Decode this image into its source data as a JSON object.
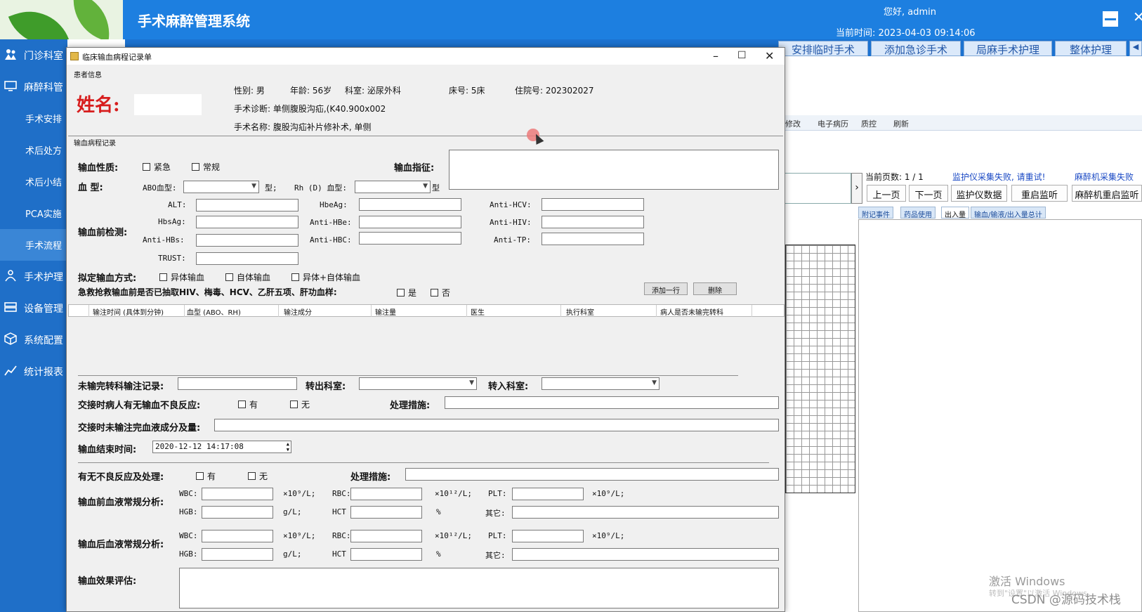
{
  "header": {
    "title": "手术麻醉管理系统",
    "greeting": "您好, admin",
    "clock": "当前时间: 2023-04-03 09:14:06"
  },
  "sidebar": {
    "items": [
      {
        "label": "门诊科室",
        "icon": "people-icon"
      },
      {
        "label": "麻醉科管",
        "icon": "monitor-icon"
      },
      {
        "label": "手术安排"
      },
      {
        "label": "术后处方"
      },
      {
        "label": "术后小结"
      },
      {
        "label": "PCA实施"
      },
      {
        "label": "手术流程"
      },
      {
        "label": "手术护理",
        "icon": "nurse-icon"
      },
      {
        "label": "设备管理",
        "icon": "device-icon"
      },
      {
        "label": "系统配置",
        "icon": "cube-icon"
      },
      {
        "label": "统计报表",
        "icon": "chart-icon"
      }
    ]
  },
  "tabs": [
    "安排临时手术",
    "添加急诊手术",
    "局麻手术护理",
    "整体护理"
  ],
  "toolbar": {
    "edit": "修改",
    "emr": "电子病历",
    "qc": "质控",
    "refresh": "刷新"
  },
  "bg": {
    "page_info": "当前页数: 1 / 1",
    "monitor_fail": "监护仪采集失败, 请重试!",
    "anesthesia_fail": "麻醉机采集失败",
    "buttons": [
      "上一页",
      "下一页",
      "监护仪数据",
      "重启监听",
      "麻醉机重启监听"
    ],
    "subtabs": [
      "附记事件",
      "药品使用",
      "出入量",
      "输血/输液/出入量总计"
    ]
  },
  "watermark": {
    "line1": "激活 Windows",
    "line2": "转到\"设置\"以激活 Windows。",
    "source": "CSDN @源码技术栈"
  },
  "dialog": {
    "title": "临床输血病程记录单",
    "patient_group": "患者信息",
    "name_label": "姓名:",
    "gender": "性别: 男",
    "age": "年龄: 56岁",
    "dept": "科室: 泌尿外科",
    "bed": "床号: 5床",
    "admission": "住院号: 202302027",
    "diagnosis": "手术诊断: 单侧腹股沟疝,(K40.900x002",
    "surgery": "手术名称: 腹股沟疝补片修补术, 单侧",
    "record_group": "输血病程记录",
    "nature_label": "输血性质:",
    "urgent": "紧急",
    "routine": "常规",
    "indication_label": "输血指征:",
    "blood_type_label": "血    型:",
    "abo_label": "ABO血型:",
    "type_suffix": "型;",
    "rh_label": "Rh (D) 血型:",
    "type_suffix2": "型",
    "pretest_label": "输血前检测:",
    "tests": {
      "alt": "ALT:",
      "hbsag": "HbsAg:",
      "antihbs": "Anti-HBs:",
      "trust": "TRUST:",
      "hbeag": "HbeAg:",
      "antihbe": "Anti-HBe:",
      "antihbc": "Anti-HBC:",
      "antihcv": "Anti-HCV:",
      "antihiv": "Anti-HIV:",
      "antitp": "Anti-TP:"
    },
    "method_label": "拟定输血方式:",
    "m1": "异体输血",
    "m2": "自体输血",
    "m3": "异体+自体输血",
    "emergency_label": "急救抢救输血前是否已抽取HIV、梅毒、HCV、乙肝五项、肝功血样:",
    "yes": "是",
    "no": "否",
    "add_row": "添加一行",
    "delete": "删除",
    "columns": [
      "输注时间 (具体到分钟)",
      "血型 (ABO、RH)",
      "输注成分",
      "输注量",
      "医生",
      "执行科室",
      "病人是否未输完转科"
    ],
    "transfer_label": "未输完转科输注记录:",
    "out_dept": "转出科室:",
    "in_dept": "转入科室:",
    "handover_label": "交接时病人有无输血不良反应:",
    "has": "有",
    "none": "无",
    "measures": "处理措施:",
    "remaining_label": "交接时未输注完血液成分及量:",
    "end_label": "输血结束时间:",
    "end_time": "2020-12-12  14:17:08",
    "adverse_label": "有无不良反应及处理:",
    "pre_cbc": "输血前血液常规分析:",
    "post_cbc": "输血后血液常规分析:",
    "wbc": "WBC:",
    "rbc": "RBC:",
    "plt": "PLT:",
    "hgb": "HGB:",
    "hct": "HCT",
    "u_wbc": "×10⁹/L;",
    "u_rbc": "×10¹²/L;",
    "u_plt": "×10⁹/L;",
    "u_hgb": "g/L;",
    "u_hct": "%",
    "other": "其它:",
    "eval_label": "输血效果评估:"
  }
}
